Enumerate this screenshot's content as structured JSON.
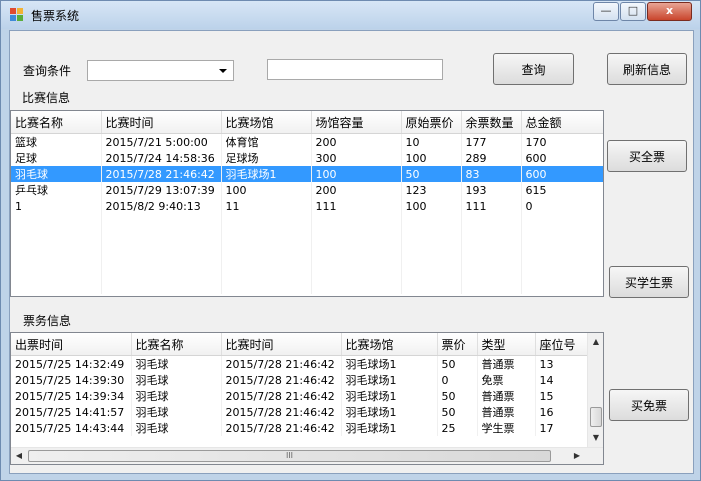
{
  "window": {
    "title": "售票系统",
    "minimize_glyph": "—",
    "maximize_glyph": "□",
    "close_glyph": "x",
    "icon": "app-tiles-icon"
  },
  "query": {
    "condition_label": "查询条件",
    "condition_value": "",
    "text_value": "",
    "query_button": "查询",
    "refresh_button": "刷新信息"
  },
  "match_section": {
    "label": "比赛信息",
    "columns": [
      "比赛名称",
      "比赛时间",
      "比赛场馆",
      "场馆容量",
      "原始票价",
      "余票数量",
      "总金额"
    ],
    "rows": [
      [
        "篮球",
        "2015/7/21 5:00:00",
        "体育馆",
        "200",
        "10",
        "177",
        "170"
      ],
      [
        "足球",
        "2015/7/24 14:58:36",
        "足球场",
        "300",
        "100",
        "289",
        "600"
      ],
      [
        "羽毛球",
        "2015/7/28 21:46:42",
        "羽毛球场1",
        "100",
        "50",
        "83",
        "600"
      ],
      [
        "乒乓球",
        "2015/7/29 13:07:39",
        "100",
        "200",
        "123",
        "193",
        "615"
      ],
      [
        "1",
        "2015/8/2 9:40:13",
        "11",
        "111",
        "100",
        "111",
        "0"
      ]
    ],
    "selected_row": 2
  },
  "ticket_section": {
    "label": "票务信息",
    "columns": [
      "出票时间",
      "比赛名称",
      "比赛时间",
      "比赛场馆",
      "票价",
      "类型",
      "座位号"
    ],
    "rows": [
      [
        "2015/7/25 14:32:49",
        "羽毛球",
        "2015/7/28 21:46:42",
        "羽毛球场1",
        "50",
        "普通票",
        "13"
      ],
      [
        "2015/7/25 14:39:30",
        "羽毛球",
        "2015/7/28 21:46:42",
        "羽毛球场1",
        "0",
        "免票",
        "14"
      ],
      [
        "2015/7/25 14:39:34",
        "羽毛球",
        "2015/7/28 21:46:42",
        "羽毛球场1",
        "50",
        "普通票",
        "15"
      ],
      [
        "2015/7/25 14:41:57",
        "羽毛球",
        "2015/7/28 21:46:42",
        "羽毛球场1",
        "50",
        "普通票",
        "16"
      ],
      [
        "2015/7/25 14:43:44",
        "羽毛球",
        "2015/7/28 21:46:42",
        "羽毛球场1",
        "25",
        "学生票",
        "17"
      ]
    ],
    "hscroll_grip": "III"
  },
  "actions": {
    "buy_full": "买全票",
    "buy_student": "买学生票",
    "buy_free": "买免票"
  },
  "colors": {
    "selection": "#3399ff",
    "titlebar": "#bfd3e8",
    "close": "#c9452c"
  }
}
